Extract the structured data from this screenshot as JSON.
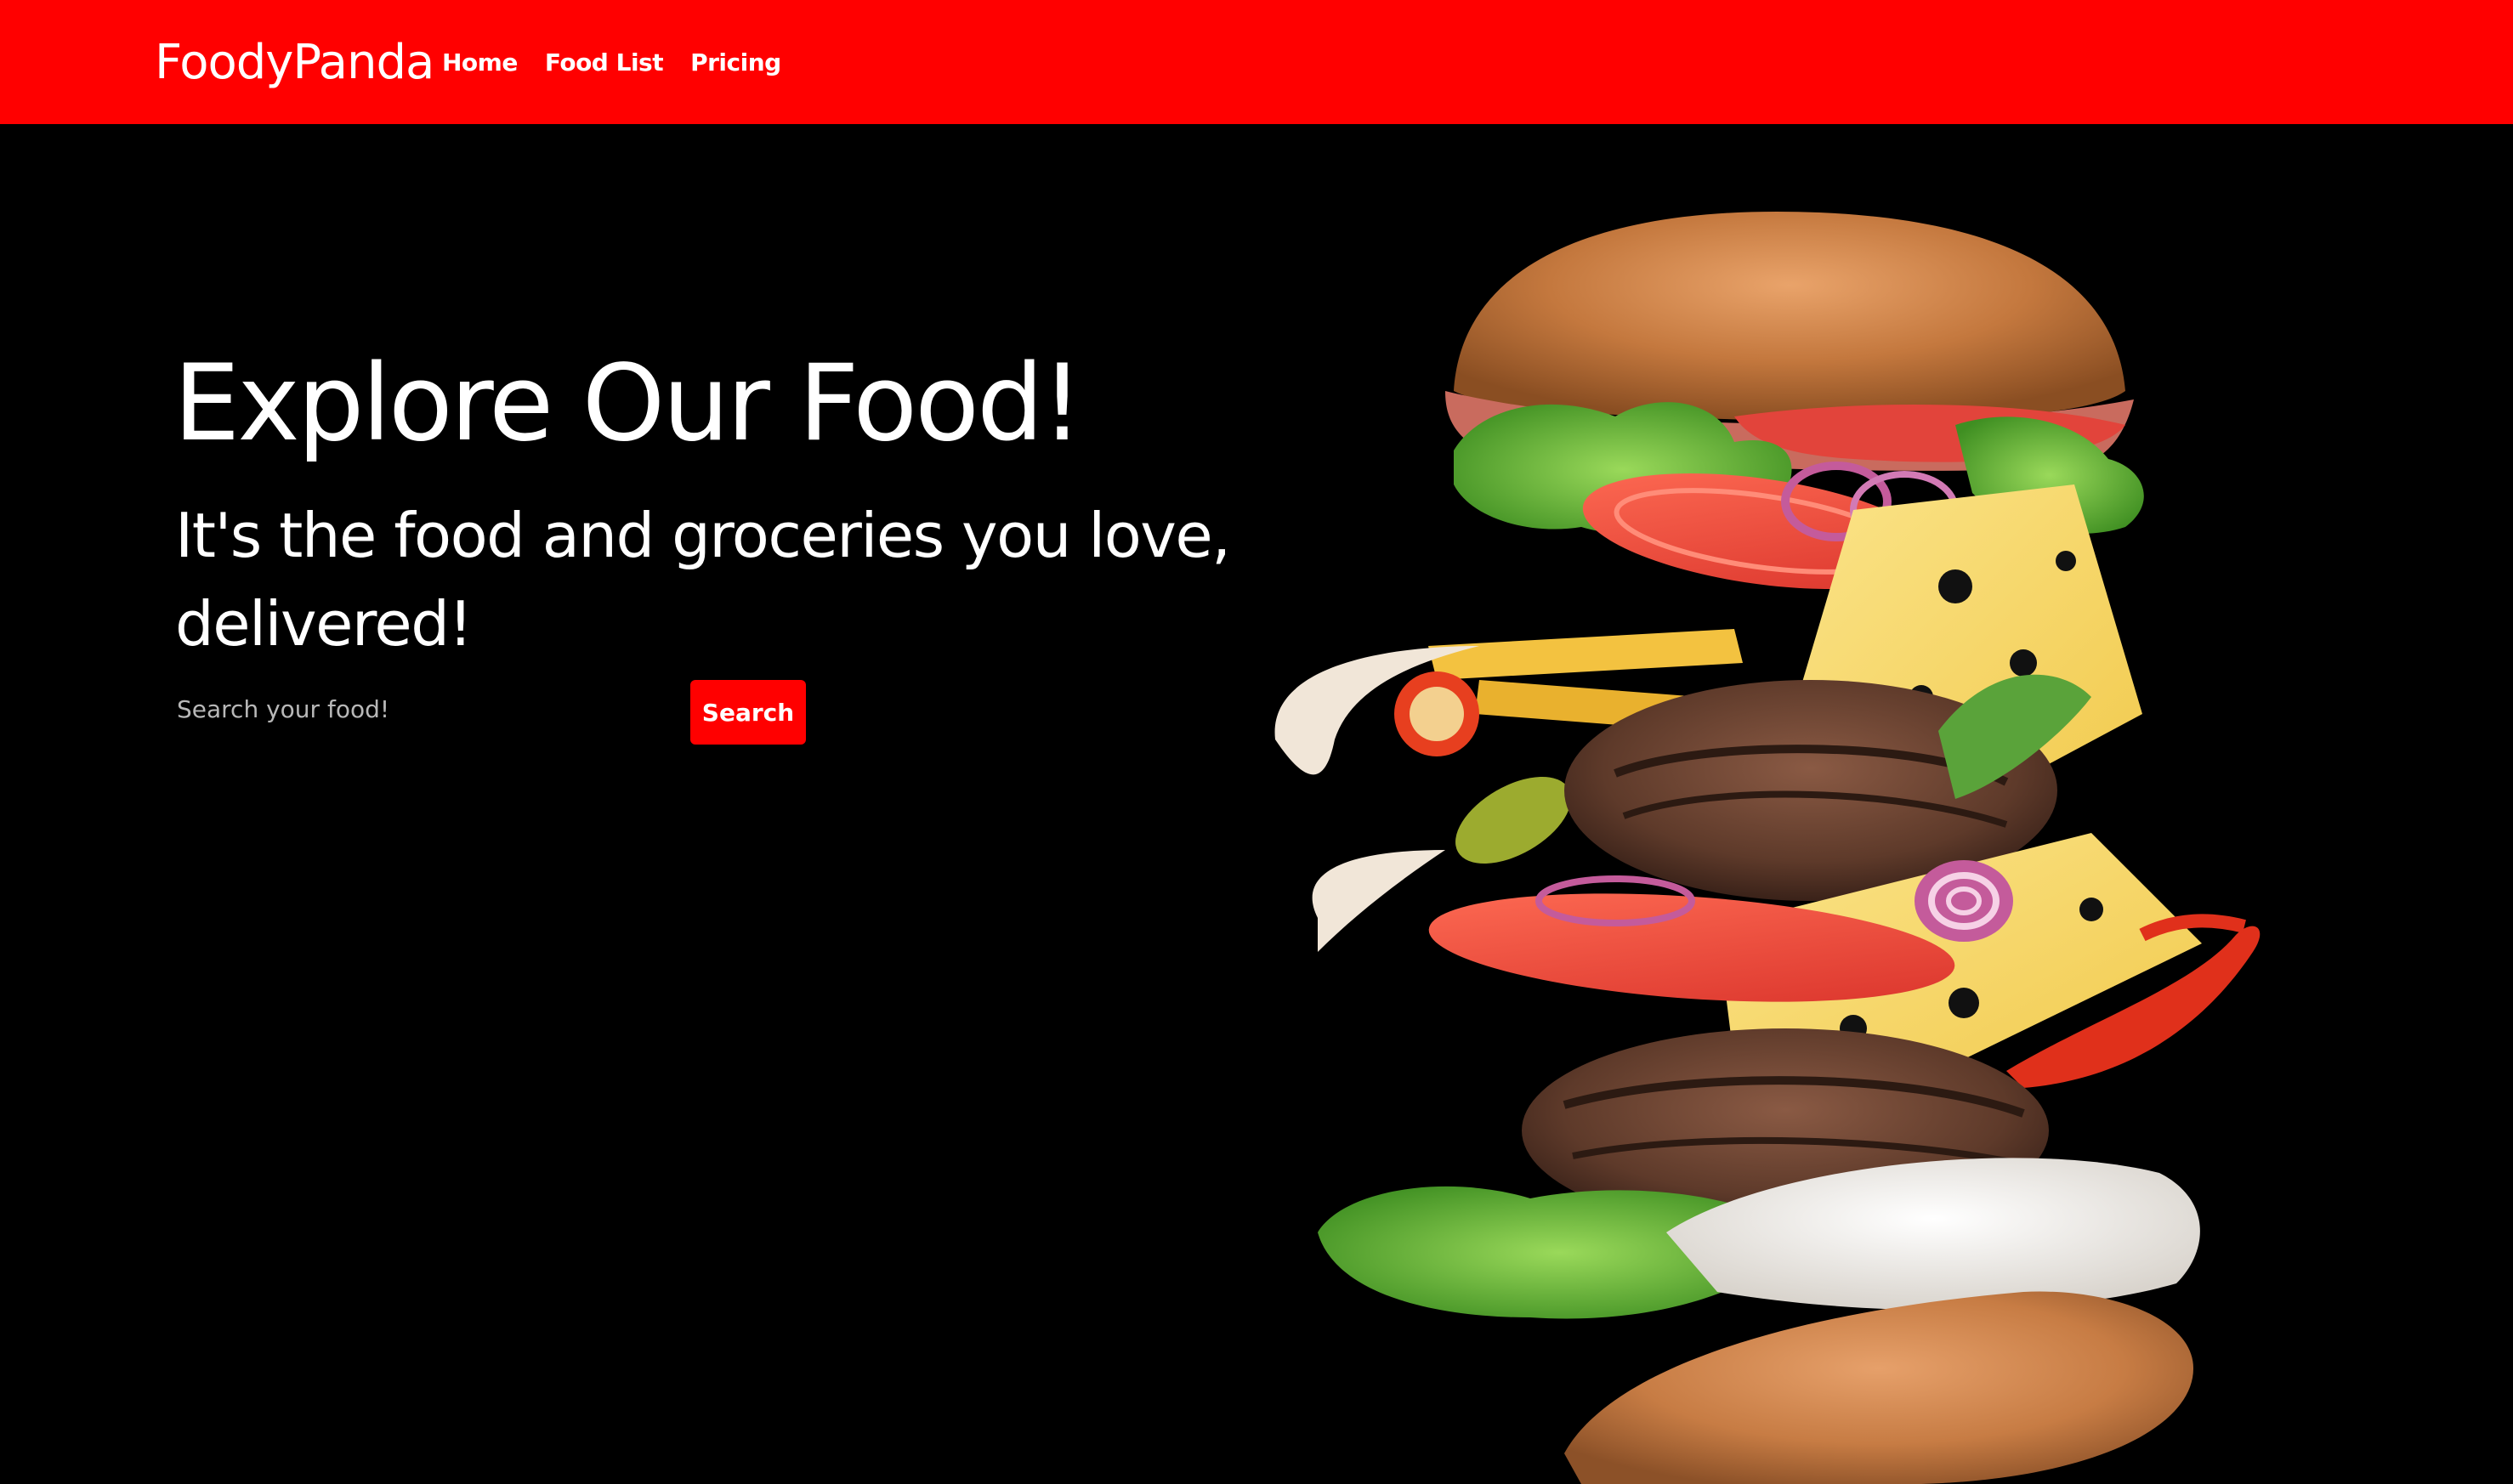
{
  "navbar": {
    "brand": "FoodyPanda",
    "links": [
      {
        "label": "Home"
      },
      {
        "label": "Food List"
      },
      {
        "label": "Pricing"
      }
    ],
    "background_color": "#ff0000"
  },
  "hero": {
    "title": "Explore Our Food!",
    "subtitle": "It's the food and groceries you love, delivered!",
    "image_icon": "burger-illustration"
  },
  "search": {
    "placeholder": "Search your food!",
    "value": "",
    "button_label": "Search"
  },
  "colors": {
    "accent": "#ff0000",
    "background": "#000000",
    "text": "#ffffff"
  }
}
